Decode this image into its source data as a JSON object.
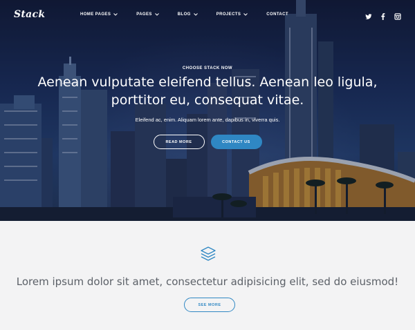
{
  "brand": {
    "logo": "Stack"
  },
  "nav": {
    "items": [
      {
        "label": "HOME PAGES",
        "has_dropdown": true
      },
      {
        "label": "PAGES",
        "has_dropdown": true
      },
      {
        "label": "BLOG",
        "has_dropdown": true
      },
      {
        "label": "PROJECTS",
        "has_dropdown": true
      },
      {
        "label": "CONTACT",
        "has_dropdown": false
      }
    ],
    "social": [
      "twitter-icon",
      "facebook-icon",
      "instagram-icon"
    ]
  },
  "hero": {
    "eyebrow": "CHOOSE STACK NOW",
    "headline_line1": "Aenean vulputate eleifend tellus. Aenean leo ligula,",
    "headline_line2": "porttitor eu, consequat vitae.",
    "subtext": "Eleifend ac, enim. Aliquam lorem ante, dapibus in, viverra quis.",
    "primary_button": "READ MORE",
    "secondary_button": "CONTACT US"
  },
  "feature": {
    "icon": "layers-icon",
    "tagline": "Lorem ipsum dolor sit amet, consectetur adipisicing elit, sed do eiusmod!",
    "button": "SEE MORE"
  },
  "colors": {
    "accent": "#2f87c3",
    "hero_dark": "#141c3a",
    "section_bg": "#f3f3f4",
    "tagline_text": "#5c6168"
  }
}
